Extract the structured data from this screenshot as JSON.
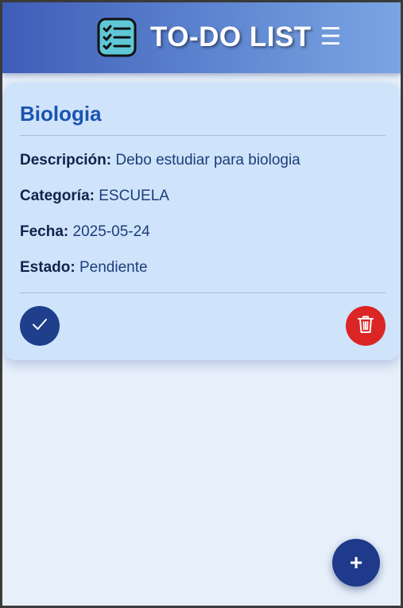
{
  "header": {
    "title": "TO-DO LIST",
    "logo_icon": "checklist-icon",
    "menu_icon": "hamburger-menu-icon",
    "menu_glyph": "☰",
    "gradient_start": "#3f5db8",
    "gradient_end": "#7aa5e2"
  },
  "task": {
    "title": "Biologia",
    "description_label": "Descripción:",
    "description_value": "Debo estudiar para biologia",
    "category_label": "Categoría:",
    "category_value": "ESCUELA",
    "date_label": "Fecha:",
    "date_value": "2025-05-24",
    "status_label": "Estado:",
    "status_value": "Pendiente",
    "complete_icon": "checkmark-icon",
    "delete_icon": "trash-icon"
  },
  "fab": {
    "icon": "plus-icon",
    "glyph": "+"
  },
  "colors": {
    "accent": "#1f3f8c",
    "danger": "#dc2525",
    "card_background": "#cfe3fb",
    "page_background": "#e7f0fa",
    "title_blue": "#1b54b0"
  }
}
